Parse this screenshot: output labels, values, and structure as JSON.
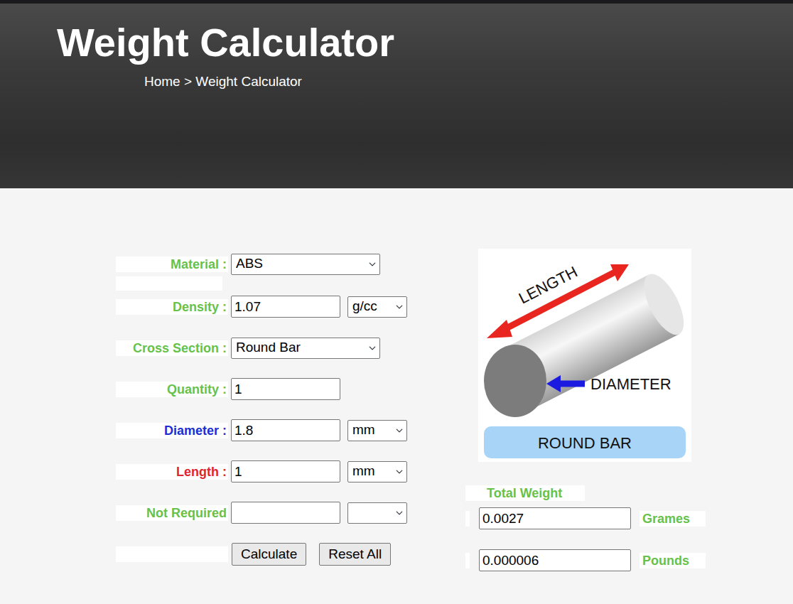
{
  "header": {
    "title": "Weight Calculator",
    "breadcrumb": "Home > Weight Calculator"
  },
  "form": {
    "fields": [
      {
        "label": "Material :",
        "kind": "select",
        "value": "ABS",
        "color": "#66c24a"
      },
      {
        "label": "Density :",
        "kind": "input-unit",
        "value": "1.07",
        "unit": "g/cc",
        "color": "#66c24a"
      },
      {
        "label": "Cross Section :",
        "kind": "select",
        "value": "Round Bar",
        "color": "#66c24a"
      },
      {
        "label": "Quantity :",
        "kind": "input",
        "value": "1",
        "color": "#66c24a"
      },
      {
        "label": "Diameter :",
        "kind": "input-unit",
        "value": "1.8",
        "unit": "mm",
        "color": "#1b2fd4"
      },
      {
        "label": "Length :",
        "kind": "input-unit",
        "value": "1",
        "unit": "mm",
        "color": "#e0262e"
      },
      {
        "label": "Not Required",
        "kind": "input-unit",
        "value": "",
        "unit": "",
        "color": "#66c24a"
      }
    ],
    "buttons": [
      "Calculate",
      "Reset All"
    ]
  },
  "diagram": {
    "length_label": "LENGTH",
    "diameter_label": "DIAMETER",
    "caption": "ROUND BAR"
  },
  "result": {
    "title": "Total Weight",
    "rows": [
      {
        "value": "0.0027",
        "unit": "Grames"
      },
      {
        "value": "0.000006",
        "unit": "Pounds"
      }
    ]
  }
}
